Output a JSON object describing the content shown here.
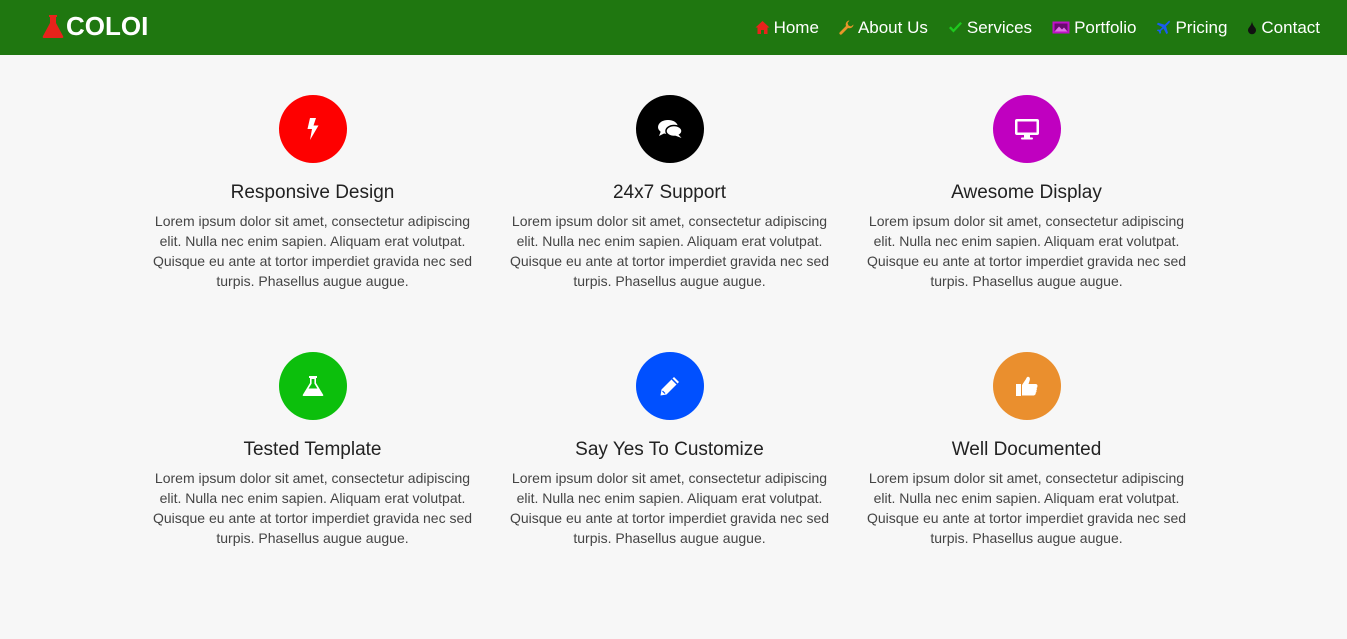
{
  "navbar": {
    "brand": "COLOI",
    "brand_icon": "flask-icon",
    "background": "#1f7710",
    "items": [
      {
        "label": "Home",
        "icon": "home-icon",
        "icon_color": "#e8231b"
      },
      {
        "label": "About Us",
        "icon": "wrench-icon",
        "icon_color": "#e8962a"
      },
      {
        "label": "Services",
        "icon": "check-icon",
        "icon_color": "#1ec91e"
      },
      {
        "label": "Portfolio",
        "icon": "picture-icon",
        "icon_color": "#c011c9"
      },
      {
        "label": "Pricing",
        "icon": "plane-icon",
        "icon_color": "#1a5cf0"
      },
      {
        "label": "Contact",
        "icon": "drop-icon",
        "icon_color": "#111111"
      }
    ]
  },
  "features": [
    {
      "title": "Responsive Design",
      "icon": "bolt-icon",
      "color": "#fe0000",
      "text": "Lorem ipsum dolor sit amet, consectetur adipiscing elit. Nulla nec enim sapien. Aliquam erat volutpat. Quisque eu ante at tortor imperdiet gravida nec sed turpis. Phasellus augue augue."
    },
    {
      "title": "24x7 Support",
      "icon": "comments-icon",
      "color": "#000000",
      "text": "Lorem ipsum dolor sit amet, consectetur adipiscing elit. Nulla nec enim sapien. Aliquam erat volutpat. Quisque eu ante at tortor imperdiet gravida nec sed turpis. Phasellus augue augue."
    },
    {
      "title": "Awesome Display",
      "icon": "desktop-icon",
      "color": "#c000c0",
      "text": "Lorem ipsum dolor sit amet, consectetur adipiscing elit. Nulla nec enim sapien. Aliquam erat volutpat. Quisque eu ante at tortor imperdiet gravida nec sed turpis. Phasellus augue augue."
    },
    {
      "title": "Tested Template",
      "icon": "flask-icon",
      "color": "#0cbf0c",
      "text": "Lorem ipsum dolor sit amet, consectetur adipiscing elit. Nulla nec enim sapien. Aliquam erat volutpat. Quisque eu ante at tortor imperdiet gravida nec sed turpis. Phasellus augue augue."
    },
    {
      "title": "Say Yes To Customize",
      "icon": "pencil-icon",
      "color": "#0050ff",
      "text": "Lorem ipsum dolor sit amet, consectetur adipiscing elit. Nulla nec enim sapien. Aliquam erat volutpat. Quisque eu ante at tortor imperdiet gravida nec sed turpis. Phasellus augue augue."
    },
    {
      "title": "Well Documented",
      "icon": "thumbs-up-icon",
      "color": "#ea8f2e",
      "text": "Lorem ipsum dolor sit amet, consectetur adipiscing elit. Nulla nec enim sapien. Aliquam erat volutpat. Quisque eu ante at tortor imperdiet gravida nec sed turpis. Phasellus augue augue."
    }
  ]
}
